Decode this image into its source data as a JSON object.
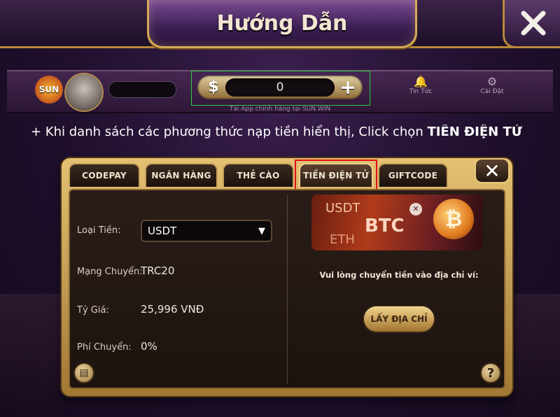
{
  "header": {
    "title": "Hướng Dẫn",
    "close_icon": "close-icon"
  },
  "game_bar": {
    "logo_text": "SUN",
    "balance": "0",
    "currency_symbol": "$",
    "add_symbol": "+",
    "news_label": "Tin Tức",
    "settings_label": "Cài Đặt",
    "tagline": "Tải App chính hãng tại SUN.WIN"
  },
  "instruction": {
    "text": "+ Khi danh sách các phương thức nạp tiền hiển thị, Click chọn ",
    "highlight": "TIỀN ĐIỆN TỬ"
  },
  "dialog": {
    "tabs": [
      {
        "label": "CODEPAY",
        "active": false
      },
      {
        "label": "NGÂN HÀNG",
        "active": false
      },
      {
        "label": "THẺ CÀO",
        "active": false
      },
      {
        "label": "TIỀN ĐIỆN TỬ",
        "active": true
      },
      {
        "label": "GIFTCODE",
        "active": false
      }
    ],
    "close_label": "✕",
    "currency": {
      "label": "Loại Tiền:",
      "value": "USDT"
    },
    "network": {
      "label": "Mạng Chuyển:",
      "value": "TRC20"
    },
    "rate": {
      "label": "Tỷ Giá:",
      "value": "25,996 VNĐ"
    },
    "fee": {
      "label": "Phí Chuyển:",
      "value": "0%"
    },
    "banner": {
      "usdt": "USDT",
      "btc": "BTC",
      "eth": "ETH",
      "coin": "₿"
    },
    "wallet_text": "Vui lòng chuyển tiền vào địa chỉ ví:",
    "address_button": "LẤY ĐỊA CHỈ",
    "help_label": "?"
  },
  "colors": {
    "accent_gold": "#d6aa55",
    "highlight_red": "#e1111a",
    "selection_green": "#2ecc40",
    "background": "#1f0f2c"
  }
}
